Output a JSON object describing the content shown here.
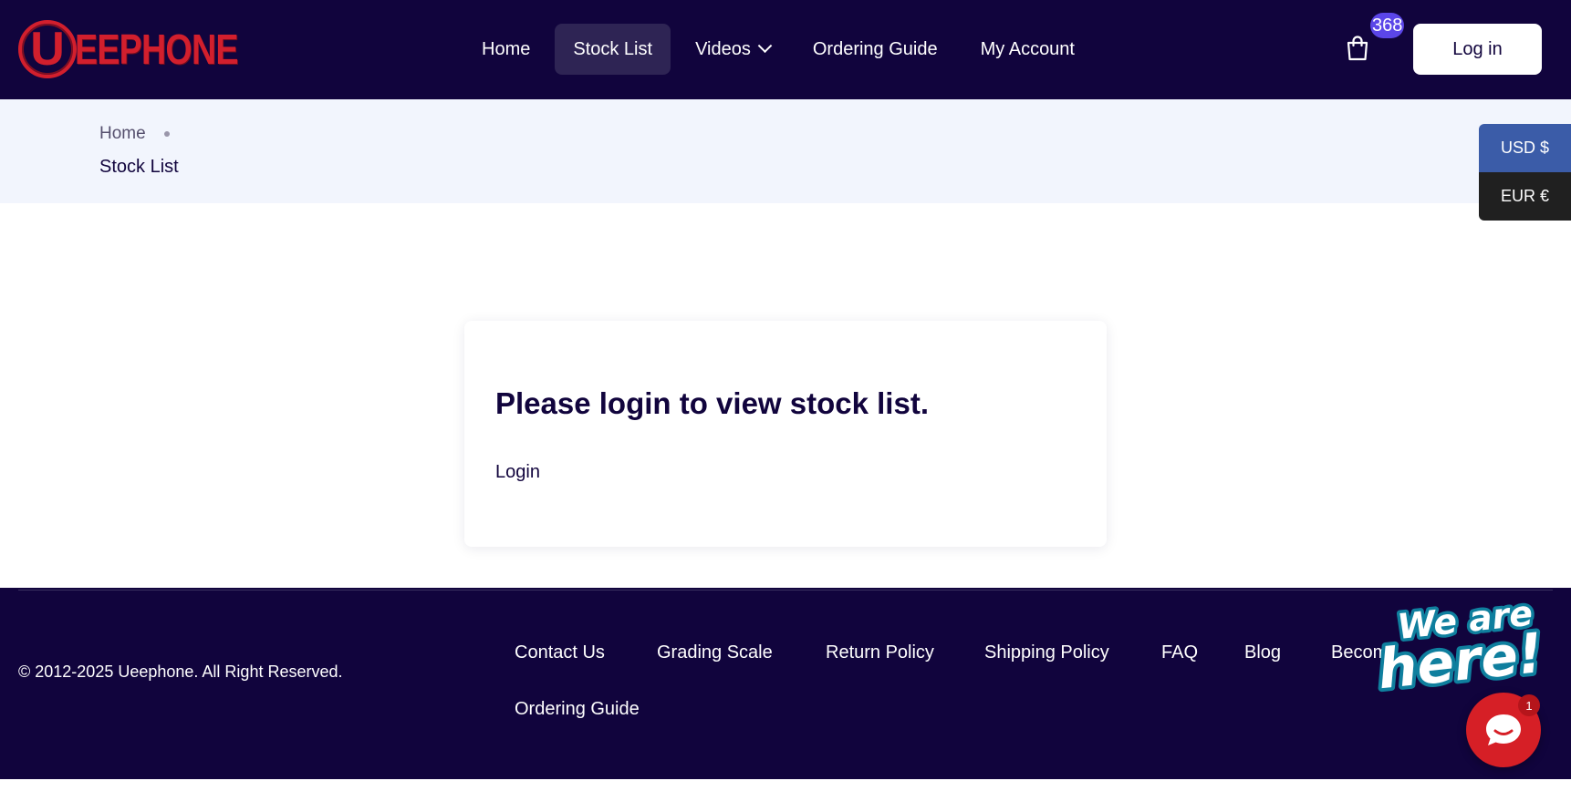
{
  "header": {
    "logo_letter": "U",
    "logo_text": "EEPHONE",
    "nav": [
      {
        "label": "Home"
      },
      {
        "label": "Stock List"
      },
      {
        "label": "Videos"
      },
      {
        "label": "Ordering Guide"
      },
      {
        "label": "My Account"
      }
    ],
    "cart_count": "368",
    "login_label": "Log in"
  },
  "breadcrumb": {
    "home": "Home",
    "current": "Stock List"
  },
  "currency": {
    "usd": "USD $",
    "eur": "EUR €"
  },
  "main": {
    "title": "Please login to view stock list.",
    "login_link": "Login"
  },
  "footer": {
    "copyright": "© 2012-2025 Ueephone. All Right Reserved.",
    "links": [
      {
        "label": "Contact Us"
      },
      {
        "label": "Grading Scale"
      },
      {
        "label": "Return Policy"
      },
      {
        "label": "Shipping Policy"
      },
      {
        "label": "FAQ"
      },
      {
        "label": "Blog"
      },
      {
        "label": "Become"
      },
      {
        "label": "Ordering Guide"
      }
    ]
  },
  "chat": {
    "greeting_line1": "We are",
    "greeting_line2": "here!",
    "badge": "1"
  },
  "colors": {
    "navy": "#11043d",
    "brand_red": "#d21f2d",
    "badge_purple": "#5b46e8",
    "usd_blue": "#3b5ca8",
    "crumb_bg": "#f2f5fd"
  },
  "icons": [
    "chevron-down-icon",
    "shopping-bag-icon",
    "chat-bubble-icon"
  ]
}
